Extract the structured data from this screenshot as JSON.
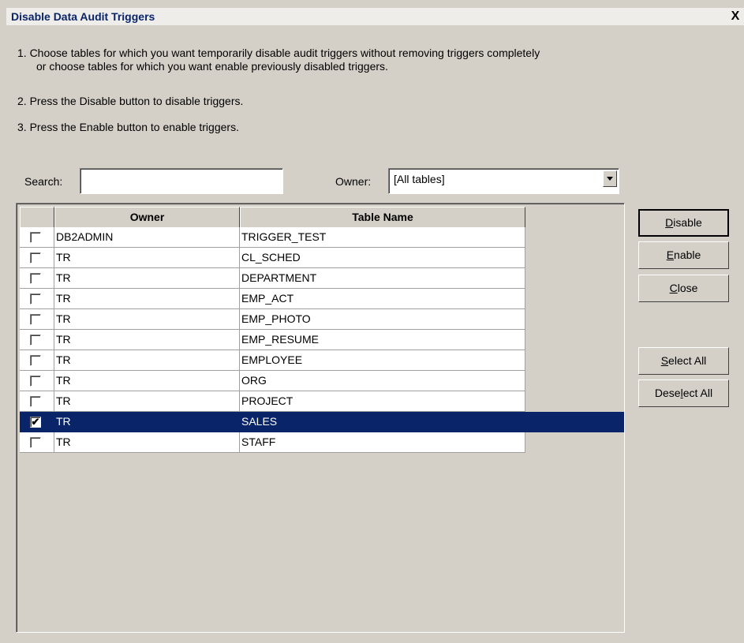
{
  "dialog": {
    "title": "Disable Data Audit Triggers",
    "close_glyph": "X"
  },
  "instructions": {
    "line1": "1.  Choose tables for which you want temporarily disable audit triggers without removing triggers completely",
    "line1b": "or choose tables for which you want enable previously disabled triggers.",
    "line2": "2.  Press the Disable button to disable triggers.",
    "line3": "3.  Press the Enable button to enable triggers."
  },
  "search": {
    "label": "Search:",
    "value": ""
  },
  "owner_filter": {
    "label": "Owner:",
    "value": "[All tables]"
  },
  "table": {
    "headers": {
      "owner": "Owner",
      "table_name": "Table Name"
    },
    "rows": [
      {
        "checked": false,
        "owner": "DB2ADMIN",
        "table": "TRIGGER_TEST"
      },
      {
        "checked": false,
        "owner": "TR",
        "table": "CL_SCHED"
      },
      {
        "checked": false,
        "owner": "TR",
        "table": "DEPARTMENT"
      },
      {
        "checked": false,
        "owner": "TR",
        "table": "EMP_ACT"
      },
      {
        "checked": false,
        "owner": "TR",
        "table": "EMP_PHOTO"
      },
      {
        "checked": false,
        "owner": "TR",
        "table": "EMP_RESUME"
      },
      {
        "checked": false,
        "owner": "TR",
        "table": "EMPLOYEE"
      },
      {
        "checked": false,
        "owner": "TR",
        "table": "ORG"
      },
      {
        "checked": false,
        "owner": "TR",
        "table": "PROJECT"
      },
      {
        "checked": true,
        "owner": "TR",
        "table": "SALES",
        "selected": true
      },
      {
        "checked": false,
        "owner": "TR",
        "table": "STAFF"
      }
    ]
  },
  "buttons": {
    "disable": "Disable",
    "enable": "Enable",
    "close": "Close",
    "select_all": "Select All",
    "deselect_all": "Deselect All"
  },
  "colors": {
    "dialog_bg": "#d4d0c8",
    "selection": "#0a246a",
    "title_text": "#0a246a"
  },
  "icons": {
    "checkbox_checked": "check-mark-icon",
    "dropdown": "chevron-down-icon",
    "close": "close-icon"
  }
}
